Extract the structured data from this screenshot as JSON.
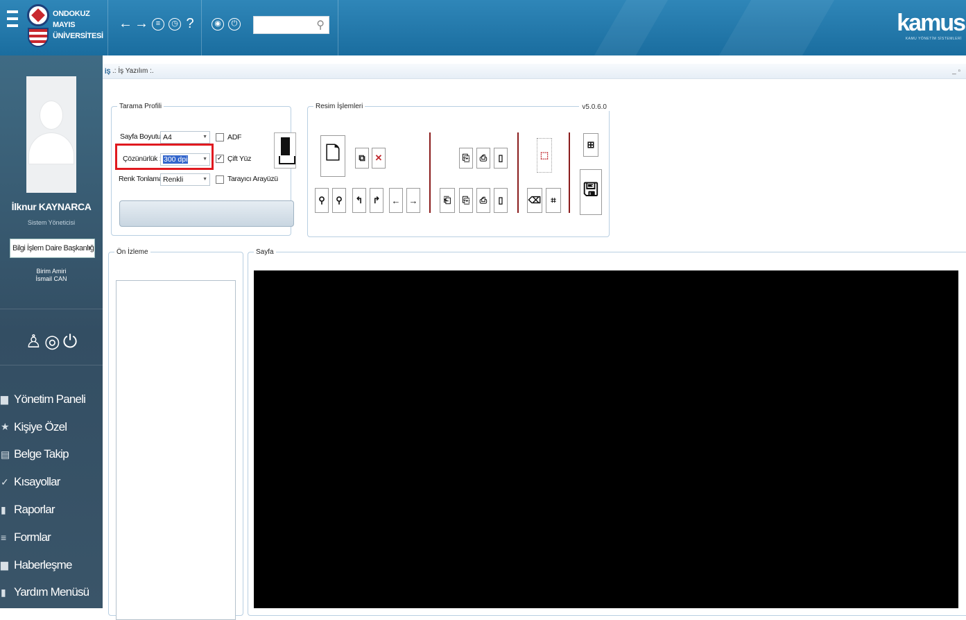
{
  "header": {
    "logo_line1": "ONDOKUZ MAYIS",
    "logo_line2": "ÜNİVERSİTESİ",
    "brand": "kamus",
    "brand_sub": "KAMU YÖNETİM SİSTEMLERİ",
    "nav_icons": [
      "back-arrow-icon",
      "forward-arrow-icon",
      "settings-circle-icon",
      "history-clock-icon",
      "help-question-icon",
      "globe-icon",
      "power-icon"
    ],
    "search_placeholder": ""
  },
  "sidebar": {
    "user_name": "İlknur KAYNARCA",
    "user_role": "Sistem Yöneticisi",
    "unit": "Bilgi İşlem Daire Başkanlığ",
    "birim_label": "Birim Amiri",
    "birim_name": "İsmail CAN",
    "menu": [
      {
        "label": "Yönetim Paneli",
        "icon": "briefcase-icon"
      },
      {
        "label": "Kişiye Özel",
        "icon": "star-icon"
      },
      {
        "label": "Belge Takip",
        "icon": "document-icon"
      },
      {
        "label": "Kısayollar",
        "icon": "check-icon"
      },
      {
        "label": "Raporlar",
        "icon": "bar-chart-icon"
      },
      {
        "label": "Formlar",
        "icon": "lines-icon"
      },
      {
        "label": "Haberleşme",
        "icon": "briefcase-icon"
      },
      {
        "label": "Yardım Menüsü",
        "icon": "bar-chart-icon"
      }
    ]
  },
  "window": {
    "logo": "İŞ",
    "title": ".: İş Yazılım :.",
    "controls": "_ ▫"
  },
  "scan_profile": {
    "legend": "Tarama Profili",
    "page_size_label": "Sayfa Boyutu :",
    "page_size_value": "A4",
    "resolution_label": "Çözünürlük :",
    "resolution_value": "300 dpi",
    "color_label": "Renk Tonlama :",
    "color_value": "Renkli",
    "adf_label": "ADF",
    "adf_checked": false,
    "duplex_label": "Çift Yüz",
    "duplex_checked": true,
    "scanner_ui_label": "Tarayıcı Arayüzü",
    "scanner_ui_checked": false
  },
  "image_ops": {
    "legend": "Resim İşlemleri",
    "version": "v5.0.6.0"
  },
  "preview": {
    "legend": "Ön İzleme"
  },
  "page": {
    "legend": "Sayfa"
  },
  "colors": {
    "highlight": "#e0191f",
    "header": "#2f86b8",
    "sidebar": "#3a5569"
  }
}
